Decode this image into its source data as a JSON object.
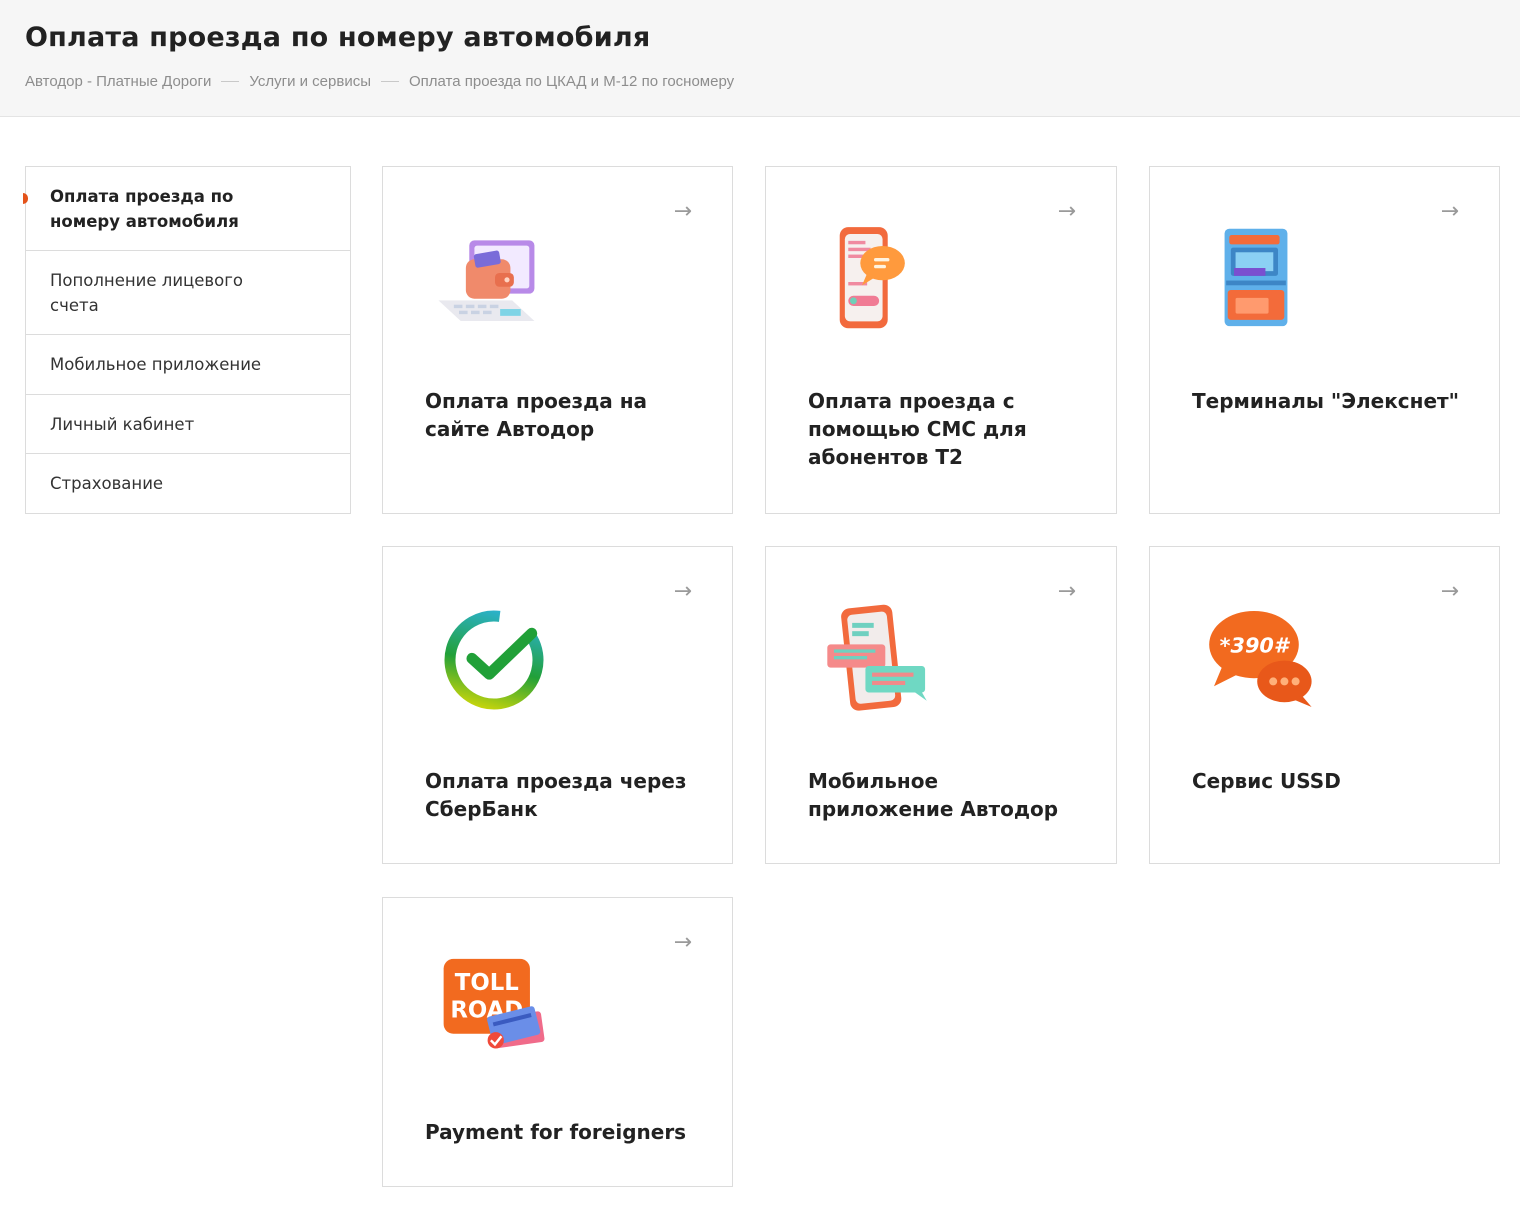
{
  "header": {
    "title": "Оплата проезда по номеру автомобиля",
    "breadcrumb": [
      "Автодор - Платные Дороги",
      "Услуги и сервисы",
      "Оплата проезда по ЦКАД и М-12 по госномеру"
    ]
  },
  "sidebar": {
    "items": [
      {
        "label": "Оплата проезда по номеру автомобиля",
        "active": true
      },
      {
        "label": "Пополнение лицевого счета",
        "active": false
      },
      {
        "label": "Мобильное приложение",
        "active": false
      },
      {
        "label": "Личный кабинет",
        "active": false
      },
      {
        "label": "Страхование",
        "active": false
      }
    ]
  },
  "cards": [
    {
      "title": "Оплата проезда на сайте Автодор",
      "icon": "wallet-laptop-icon"
    },
    {
      "title": "Оплата проезда с помощью СМС для абонентов Т2",
      "icon": "phone-sms-icon"
    },
    {
      "title": "Терминалы \"Элекснет\"",
      "icon": "terminal-icon"
    },
    {
      "title": "Оплата проезда через СберБанк",
      "icon": "sberbank-icon"
    },
    {
      "title": "Мобильное приложение Автодор",
      "icon": "mobile-app-icon"
    },
    {
      "title": "Сервис USSD",
      "icon": "ussd-icon",
      "icon_text": "*390#"
    },
    {
      "title": "Payment for foreigners",
      "icon": "toll-road-icon",
      "icon_text": [
        "TOLL",
        "ROAD"
      ]
    }
  ],
  "arrow": "→",
  "colors": {
    "accent": "#e4531a",
    "header_bg": "#f6f6f6",
    "border": "#dcdcdc",
    "muted_text": "#8d8d8d"
  }
}
